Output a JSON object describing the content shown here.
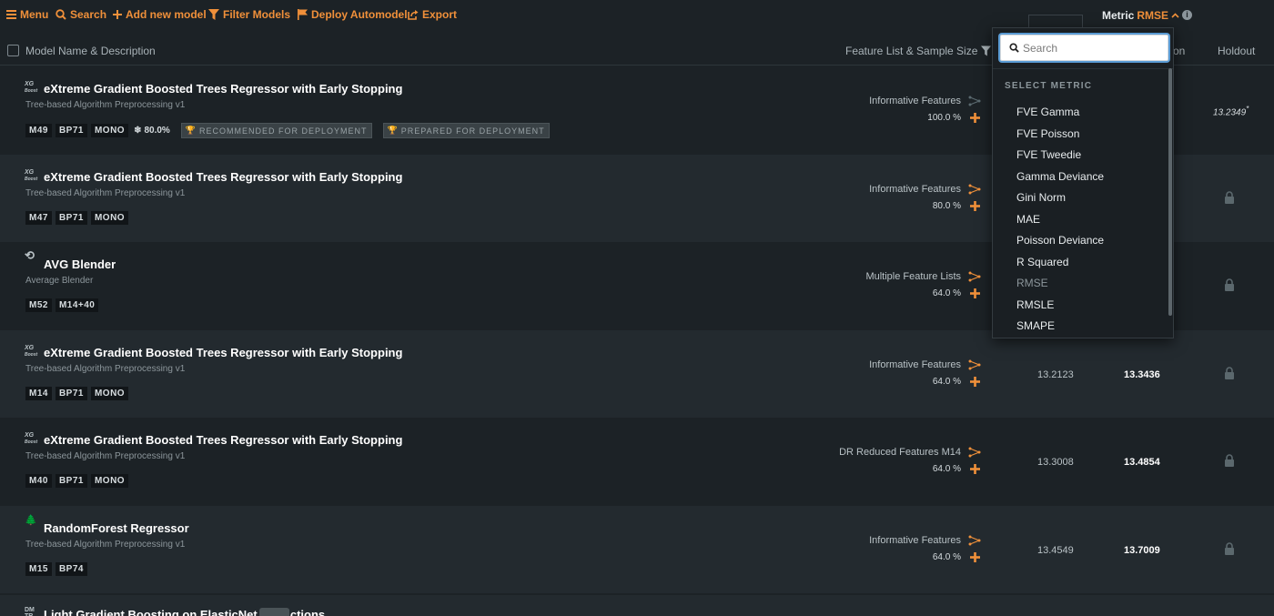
{
  "toolbar": {
    "menu": "Menu",
    "search": "Search",
    "add_model": "Add new model",
    "filter": "Filter Models",
    "deploy": "Deploy Automodel",
    "export": "Export",
    "metric_label": "Metric",
    "metric_value": "RMSE",
    "accent": "#f0903a"
  },
  "header": {
    "name": "Model Name & Description",
    "features": "Feature List & Sample Size",
    "validation_partial": "on",
    "holdout": "Holdout"
  },
  "models": [
    {
      "icon_text": [
        "XG",
        "Boost"
      ],
      "title": "eXtreme Gradient Boosted Trees Regressor with Early Stopping",
      "subtitle": "Tree-based Algorithm Preprocessing v1",
      "badges": [
        "M49",
        "BP71",
        "MONO"
      ],
      "sample_pct": "80.0%",
      "tags": [
        "RECOMMENDED FOR DEPLOYMENT",
        "PREPARED FOR DEPLOYMENT"
      ],
      "feature_list": "Informative Features",
      "sample_size": "100.0 %",
      "validation": "",
      "cross_validation": "",
      "holdout": "13.2349",
      "holdout_marker": "*"
    },
    {
      "icon_text": [
        "XG",
        "Boost"
      ],
      "title": "eXtreme Gradient Boosted Trees Regressor with Early Stopping",
      "subtitle": "Tree-based Algorithm Preprocessing v1",
      "badges": [
        "M47",
        "BP71",
        "MONO"
      ],
      "feature_list": "Informative Features",
      "sample_size": "80.0 %",
      "validation": "",
      "cross_validation": "",
      "holdout_locked": true
    },
    {
      "icon_text": [
        "⟲"
      ],
      "title": "AVG Blender",
      "subtitle": "Average Blender",
      "badges": [
        "M52",
        "M14+40"
      ],
      "feature_list": "Multiple Feature Lists",
      "sample_size": "64.0 %",
      "validation": "",
      "cross_validation": "",
      "holdout_locked": true
    },
    {
      "icon_text": [
        "XG",
        "Boost"
      ],
      "title": "eXtreme Gradient Boosted Trees Regressor with Early Stopping",
      "subtitle": "Tree-based Algorithm Preprocessing v1",
      "badges": [
        "M14",
        "BP71",
        "MONO"
      ],
      "feature_list": "Informative Features",
      "sample_size": "64.0 %",
      "validation": "13.2123",
      "cross_validation": "13.3436",
      "holdout_locked": true
    },
    {
      "icon_text": [
        "XG",
        "Boost"
      ],
      "title": "eXtreme Gradient Boosted Trees Regressor with Early Stopping",
      "subtitle": "Tree-based Algorithm Preprocessing v1",
      "badges": [
        "M40",
        "BP71",
        "MONO"
      ],
      "feature_list": "DR Reduced Features M14",
      "sample_size": "64.0 %",
      "validation": "13.3008",
      "cross_validation": "13.4854",
      "holdout_locked": true
    },
    {
      "icon_text": [
        "🌲"
      ],
      "title": "RandomForest Regressor",
      "subtitle": "Tree-based Algorithm Preprocessing v1",
      "badges": [
        "M15",
        "BP74"
      ],
      "feature_list": "Informative Features",
      "sample_size": "64.0 %",
      "validation": "13.4549",
      "cross_validation": "13.7009",
      "holdout_locked": true
    }
  ],
  "partial_row": {
    "icon_text": [
      "DM",
      "TR"
    ],
    "title": "Light Gradient Boosting on ElasticNet Predictions"
  },
  "dropdown": {
    "search_placeholder": "Search",
    "heading": "SELECT METRIC",
    "items": [
      "FVE Gamma",
      "FVE Poisson",
      "FVE Tweedie",
      "Gamma Deviance",
      "Gini Norm",
      "MAE",
      "Poisson Deviance",
      "R Squared",
      "RMSE",
      "RMSLE",
      "SMAPE"
    ],
    "selected": "RMSE"
  }
}
